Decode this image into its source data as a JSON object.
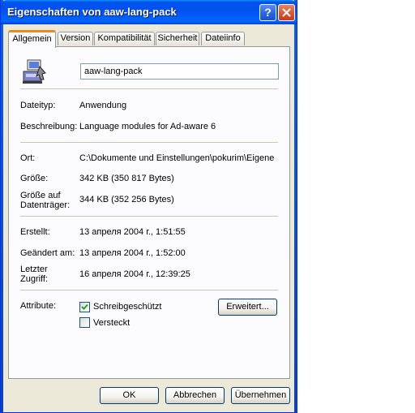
{
  "window": {
    "title": "Eigenschaften von aaw-lang-pack",
    "help_glyph": "?",
    "icons": {
      "help": "help-icon",
      "close": "close-icon",
      "app": "setup-program-icon"
    }
  },
  "tabs": [
    "Allgemein",
    "Version",
    "Kompatibilität",
    "Sicherheit",
    "Dateiinfo"
  ],
  "general": {
    "filename": "aaw-lang-pack",
    "type_label": "Dateityp:",
    "type_value": "Anwendung",
    "desc_label": "Beschreibung:",
    "desc_value": "Language modules for Ad-aware 6",
    "location_label": "Ort:",
    "location_value": "C:\\Dokumente und Einstellungen\\pokurim\\Eigene",
    "size_label": "Größe:",
    "size_value": "342 KB (350 817 Bytes)",
    "disk_size_label_1": "Größe auf",
    "disk_size_label_2": "Datenträger:",
    "disk_size_value": "344 KB (352 256 Bytes)",
    "created_label": "Erstellt:",
    "created_value": "13 апреля 2004 г., 1:51:55",
    "modified_label": "Geändert am:",
    "modified_value": "13 апреля 2004 г., 1:52:00",
    "accessed_label_1": "Letzter",
    "accessed_label_2": "Zugriff:",
    "accessed_value": "16 апреля 2004 г., 12:39:25",
    "attributes_label": "Attribute:",
    "readonly_label": "Schreibgeschützt",
    "readonly_checked": true,
    "hidden_label": "Versteckt",
    "hidden_checked": false,
    "advanced_button": "Erweitert..."
  },
  "buttons": {
    "ok": "OK",
    "cancel": "Abbrechen",
    "apply": "Übernehmen"
  },
  "colors": {
    "titlebar": "#0053ee",
    "dialog_bg": "#ece9d8",
    "tab_highlight": "#e68b2c",
    "check": "#21a121"
  }
}
